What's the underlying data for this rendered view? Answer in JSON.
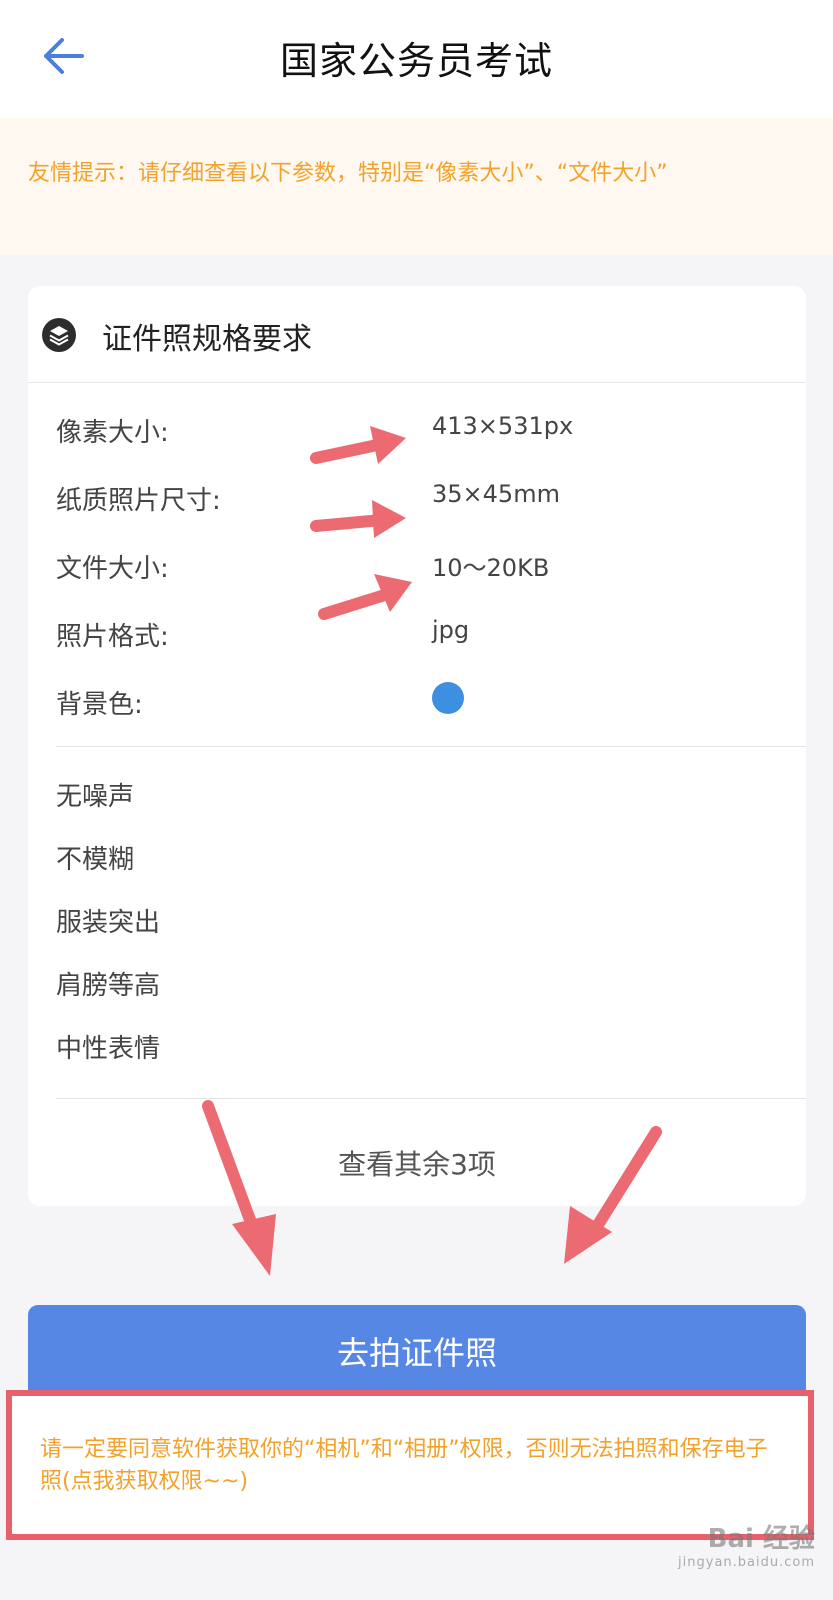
{
  "header": {
    "title": "国家公务员考试",
    "back_icon": "arrow-left-icon"
  },
  "notice": {
    "text": "友情提示：请仔细查看以下参数，特别是“像素大小”、“文件大小”"
  },
  "card": {
    "title": "证件照规格要求",
    "icon": "layers-icon",
    "specs": [
      {
        "label": "像素大小:",
        "value": "413×531px"
      },
      {
        "label": "纸质照片尺寸:",
        "value": "35×45mm"
      },
      {
        "label": "文件大小:",
        "value": "10～20KB"
      },
      {
        "label": "照片格式:",
        "value": "jpg"
      },
      {
        "label": "背景色:",
        "color": "#3d8fe0"
      }
    ],
    "requirements": [
      "无噪声",
      "不模糊",
      "服装突出",
      "肩膀等高",
      "中性表情"
    ],
    "more_label": "查看其余3项"
  },
  "primary_button": {
    "label": "去拍证件照",
    "color": "#5687e4"
  },
  "permission": {
    "text": "请一定要同意软件获取你的“相机”和“相册”权限，否则无法拍照和保存电子照(点我获取权限~~)"
  },
  "colors": {
    "accent_orange": "#f2a22b",
    "annotation_red": "#e8606b",
    "primary_blue": "#5687e4"
  },
  "watermark": {
    "brand": "Bai 经验",
    "url": "jingyan.baidu.com"
  }
}
